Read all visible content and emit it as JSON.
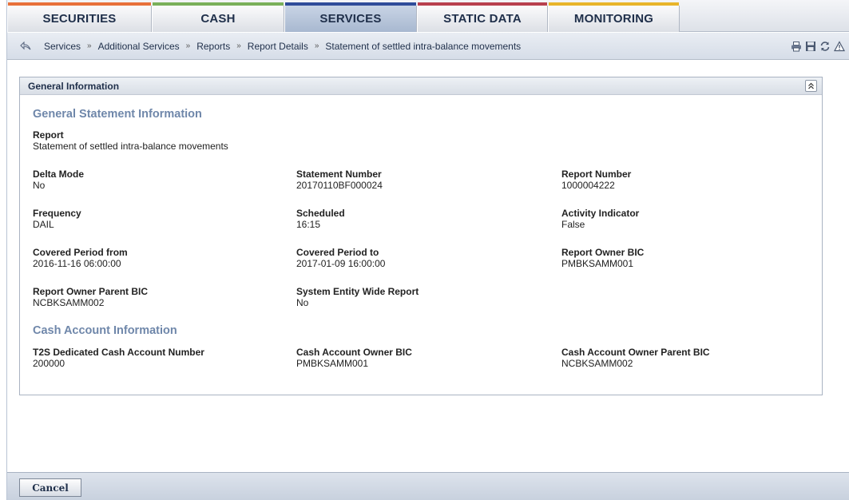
{
  "nav": {
    "tabs": [
      {
        "label": "SECURITIES",
        "color": "#e8713a",
        "active": false
      },
      {
        "label": "CASH",
        "color": "#7ab05a",
        "active": false
      },
      {
        "label": "SERVICES",
        "color": "#2f4c9a",
        "active": true
      },
      {
        "label": "STATIC DATA",
        "color": "#b8404e",
        "active": false
      },
      {
        "label": "MONITORING",
        "color": "#e8b52a",
        "active": false
      }
    ]
  },
  "breadcrumb": {
    "items": [
      "Services",
      "Additional Services",
      "Reports",
      "Report Details",
      "Statement of settled intra-balance movements"
    ],
    "separator": "»"
  },
  "toolbar_icons": [
    "print-icon",
    "save-icon",
    "refresh-icon",
    "alert-icon"
  ],
  "panel": {
    "title": "General Information",
    "general_section": {
      "title": "General Statement Information",
      "report": {
        "label": "Report",
        "value": "Statement of settled intra-balance movements"
      },
      "delta_mode": {
        "label": "Delta Mode",
        "value": "No"
      },
      "statement_number": {
        "label": "Statement Number",
        "value": "20170110BF000024"
      },
      "report_number": {
        "label": "Report Number",
        "value": "1000004222"
      },
      "frequency": {
        "label": "Frequency",
        "value": "DAIL"
      },
      "scheduled": {
        "label": "Scheduled",
        "value": "16:15"
      },
      "activity_indicator": {
        "label": "Activity Indicator",
        "value": "False"
      },
      "covered_from": {
        "label": "Covered Period from",
        "value": "2016-11-16 06:00:00"
      },
      "covered_to": {
        "label": "Covered Period to",
        "value": "2017-01-09 16:00:00"
      },
      "owner_bic": {
        "label": "Report Owner BIC",
        "value": "PMBKSAMM001"
      },
      "owner_parent_bic": {
        "label": "Report Owner Parent BIC",
        "value": "NCBKSAMM002"
      },
      "system_entity_wide": {
        "label": "System Entity Wide Report",
        "value": "No"
      }
    },
    "cash_section": {
      "title": "Cash Account Information",
      "dca_number": {
        "label": "T2S Dedicated Cash Account Number",
        "value": "200000"
      },
      "cash_owner_bic": {
        "label": "Cash Account Owner BIC",
        "value": "PMBKSAMM001"
      },
      "cash_owner_parent_bic": {
        "label": "Cash Account Owner Parent BIC",
        "value": "NCBKSAMM002"
      }
    }
  },
  "footer": {
    "cancel_label": "Cancel"
  }
}
